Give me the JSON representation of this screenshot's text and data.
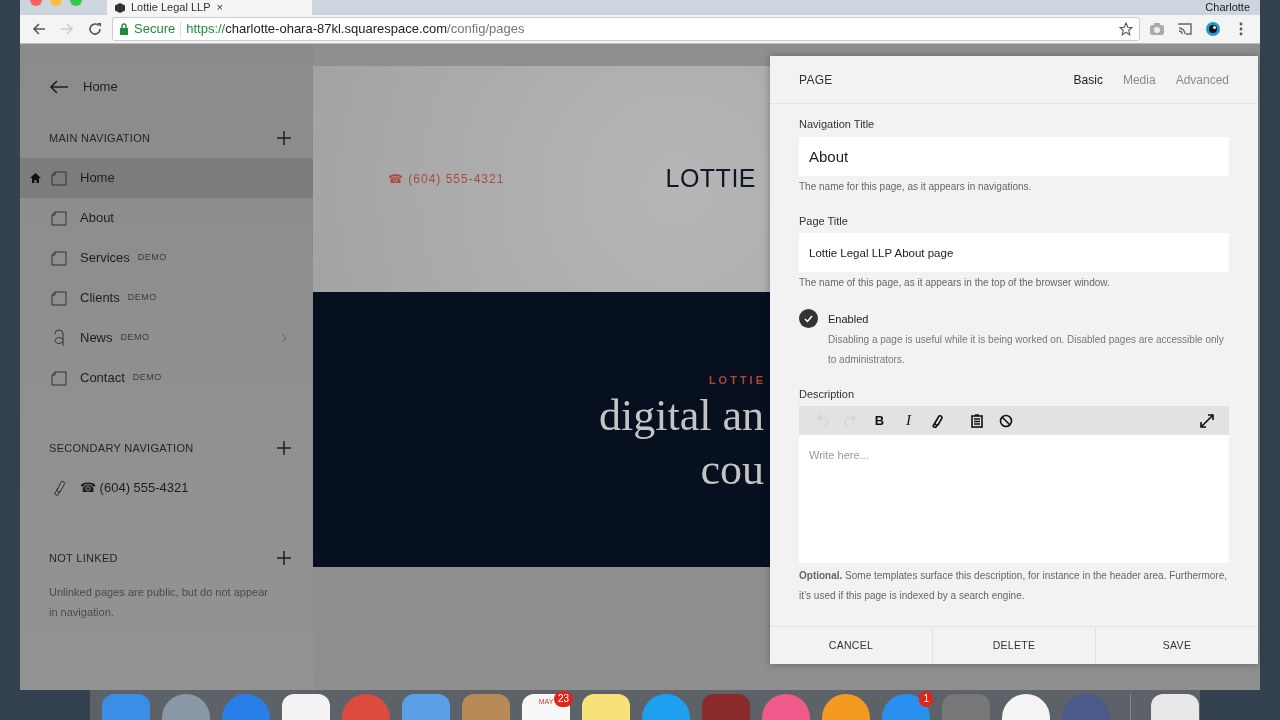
{
  "browser": {
    "tab_title": "Lottie Legal LLP",
    "tab_close": "×",
    "user_name": "Charlotte",
    "secure_label": "Secure",
    "url_scheme": "https://",
    "url_host": "charlotte-ohara-87kl.squarespace.com",
    "url_path": "/config/pages"
  },
  "sidebar": {
    "back_label": "Home",
    "sections": [
      {
        "title": "MAIN NAVIGATION",
        "items": [
          {
            "label": "Home",
            "kind": "page",
            "home": true,
            "selected": true,
            "has_children": false
          },
          {
            "label": "About",
            "kind": "page",
            "home": false,
            "selected": false,
            "has_children": false
          },
          {
            "label": "Services",
            "tag": "DEMO",
            "kind": "page",
            "home": false,
            "selected": false,
            "has_children": false
          },
          {
            "label": "Clients",
            "tag": "DEMO",
            "kind": "page",
            "home": false,
            "selected": false,
            "has_children": false
          },
          {
            "label": "News",
            "tag": "DEMO",
            "kind": "blog",
            "home": false,
            "selected": false,
            "has_children": true
          },
          {
            "label": "Contact",
            "tag": "DEMO",
            "kind": "page",
            "home": false,
            "selected": false,
            "has_children": false
          }
        ]
      },
      {
        "title": "SECONDARY NAVIGATION",
        "items": [
          {
            "label": "☎ (604) 555-4321",
            "kind": "link",
            "home": false,
            "selected": false,
            "has_children": false
          }
        ]
      },
      {
        "title": "NOT LINKED",
        "note": "Unlinked pages are public, but do not appear in navigation."
      }
    ]
  },
  "preview": {
    "phone": "☎ (604) 555-4321",
    "logo": "LOTTIE",
    "eyebrow": "LOTTIE",
    "headline_lines": [
      "digital an",
      "cou"
    ]
  },
  "panel": {
    "title": "PAGE",
    "tabs": [
      {
        "label": "Basic",
        "selected": true
      },
      {
        "label": "Media",
        "selected": false
      },
      {
        "label": "Advanced",
        "selected": false
      }
    ],
    "fields": [
      {
        "label": "Navigation Title",
        "value": "About",
        "help": "The name for this page, as it appears in navigations."
      },
      {
        "label": "Page Title",
        "value": "Lottie Legal LLP About page",
        "help": "The name of this page, as it appears in the top of the browser window."
      }
    ],
    "enabled": {
      "label": "Enabled",
      "checked": true,
      "help": "Disabling a page is useful while it is being worked on. Disabled pages are accessible only to administrators."
    },
    "description": {
      "label": "Description",
      "toolbar": [
        {
          "kind": "undo",
          "disabled": true
        },
        {
          "kind": "redo",
          "disabled": true
        },
        {
          "kind": "bold",
          "text": "B",
          "disabled": false
        },
        {
          "kind": "italic",
          "text": "I",
          "disabled": false
        },
        {
          "kind": "link",
          "disabled": false
        },
        {
          "kind": "clipboard",
          "disabled": false
        },
        {
          "kind": "clear",
          "disabled": false
        },
        {
          "kind": "expand",
          "disabled": false
        }
      ],
      "placeholder": "Write here...",
      "help": "**Optional.** Some templates surface this description, for instance in the header area. Furthermore, it’s used if this page is indexed by a search engine."
    },
    "buttons": [
      "CANCEL",
      "DELETE",
      "SAVE"
    ]
  },
  "dock": [
    {
      "kind": "finder"
    },
    {
      "kind": "launchpad"
    },
    {
      "kind": "safari"
    },
    {
      "kind": "grid"
    },
    {
      "kind": "chrome"
    },
    {
      "kind": "mail"
    },
    {
      "kind": "contacts"
    },
    {
      "kind": "calendar",
      "month": "MAY",
      "badge": "23"
    },
    {
      "kind": "notes"
    },
    {
      "kind": "blue"
    },
    {
      "kind": "photobooth"
    },
    {
      "kind": "music"
    },
    {
      "kind": "books"
    },
    {
      "kind": "appstore",
      "badge": "1"
    },
    {
      "kind": "settings"
    },
    {
      "kind": "photos"
    },
    {
      "kind": "disc"
    },
    {
      "kind": "separator"
    },
    {
      "kind": "trash"
    }
  ]
}
